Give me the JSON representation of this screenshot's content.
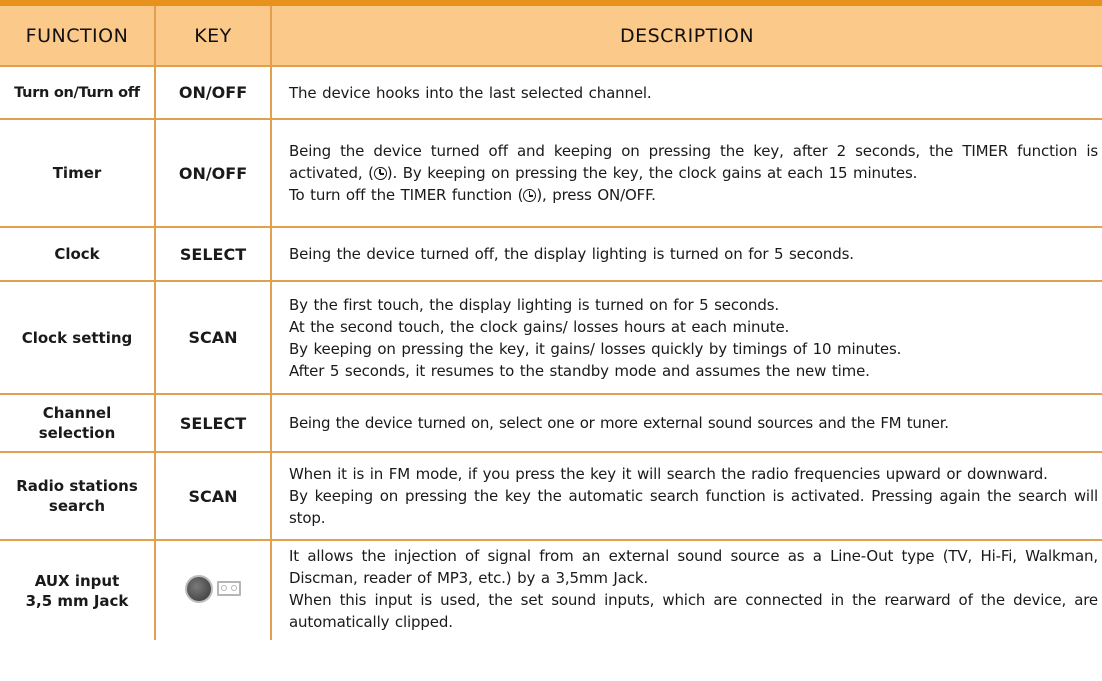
{
  "header": {
    "function": "FUNCTION",
    "key": "KEY",
    "description": "DESCRIPTION"
  },
  "rows": [
    {
      "function": "Turn on/Turn off",
      "key": "ON/OFF",
      "description": [
        "The device hooks into the last selected channel."
      ]
    },
    {
      "function": "Timer",
      "key": "ON/OFF",
      "description_parts": {
        "p1": "Being the device turned off and keeping on pressing the key, after 2 seconds, the TIMER function is activated, (",
        "p2": "). By keeping on pressing the key, the clock gains at each 15 minutes.",
        "p3": "To turn off the TIMER function (",
        "p4": "), press ON/OFF."
      }
    },
    {
      "function": "Clock",
      "key": "SELECT",
      "description": [
        "Being the device turned off, the display lighting is turned on for 5 seconds."
      ]
    },
    {
      "function": "Clock setting",
      "key": "SCAN",
      "description": [
        "By the first touch, the display lighting is turned on for 5 seconds.",
        "At the second touch, the clock gains/ losses hours at each minute.",
        "By keeping on pressing the key, it gains/ losses quickly by timings of 10 minutes.",
        "After 5 seconds, it resumes to the standby mode and assumes the new time."
      ]
    },
    {
      "function": "Channel selection",
      "key": "SELECT",
      "description": [
        "Being the device turned on, select one or more external sound sources and the FM tuner."
      ]
    },
    {
      "function": "Radio stations search",
      "key": "SCAN",
      "description": [
        "When it is in FM mode, if you press the key it will search the radio frequencies upward or downward.",
        "By keeping on pressing the key the automatic search function is activated. Pressing again the search will stop."
      ]
    },
    {
      "function": "AUX input 3,5 mm Jack",
      "key_icon": "aux-jack-icon",
      "description": [
        "It allows the injection of signal from an external sound source as a Line-Out type (TV, Hi-Fi, Walkman, Discman, reader of MP3, etc.) by a 3,5mm Jack.",
        "When this input is used, the set sound inputs, which are connected in the rearward of the device, are automatically clipped."
      ]
    }
  ],
  "colors": {
    "accent_bar": "#e8921e",
    "header_bg": "#fbc98a",
    "grid_line": "#e0a050"
  }
}
